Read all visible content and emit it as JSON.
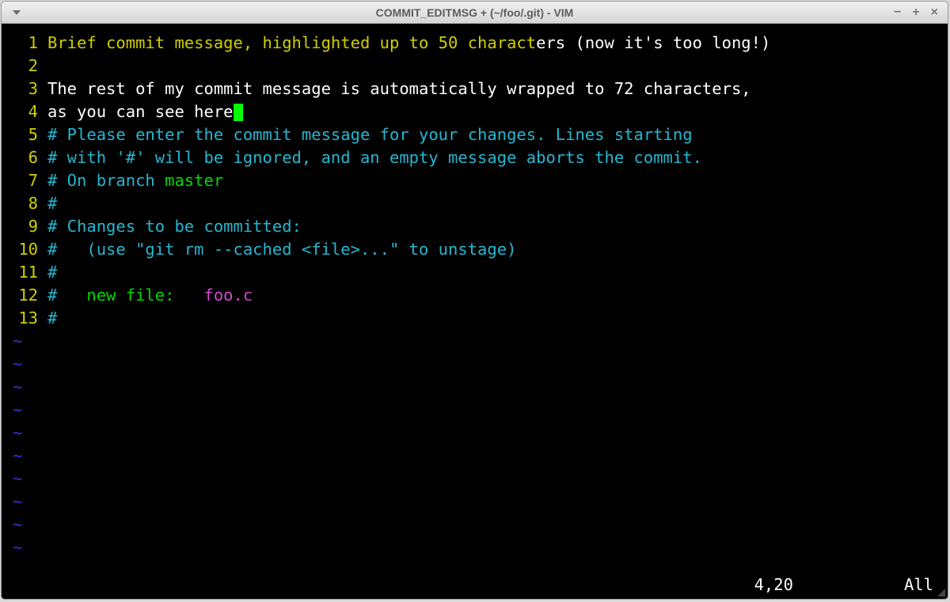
{
  "window": {
    "title": "COMMIT_EDITMSG + (~/foo/.git) - VIM"
  },
  "lines": [
    {
      "num": "1",
      "segments": [
        {
          "style": "c-yellow",
          "text": "Brief commit message, highlighted up to 50 charact"
        },
        {
          "style": "c-white",
          "text": "ers (now it's too long!)"
        }
      ]
    },
    {
      "num": "2",
      "segments": []
    },
    {
      "num": "3",
      "segments": [
        {
          "style": "c-white",
          "text": "The rest of my commit message is automatically wrapped to 72 characters,"
        }
      ]
    },
    {
      "num": "4",
      "cursor_after": true,
      "segments": [
        {
          "style": "c-white",
          "text": "as you can see here"
        }
      ]
    },
    {
      "num": "5",
      "segments": [
        {
          "style": "c-blue",
          "text": "# Please enter the commit message for your changes. Lines starting"
        }
      ]
    },
    {
      "num": "6",
      "segments": [
        {
          "style": "c-blue",
          "text": "# with '#' will be ignored, and an empty message aborts the commit."
        }
      ]
    },
    {
      "num": "7",
      "segments": [
        {
          "style": "c-blue",
          "text": "# On branch "
        },
        {
          "style": "c-green",
          "text": "master"
        }
      ]
    },
    {
      "num": "8",
      "segments": [
        {
          "style": "c-blue",
          "text": "#"
        }
      ]
    },
    {
      "num": "9",
      "segments": [
        {
          "style": "c-blue",
          "text": "# Changes to be committed:"
        }
      ]
    },
    {
      "num": "10",
      "segments": [
        {
          "style": "c-blue",
          "text": "#   (use \"git rm --cached <file>...\" to unstage)"
        }
      ]
    },
    {
      "num": "11",
      "segments": [
        {
          "style": "c-blue",
          "text": "#"
        }
      ]
    },
    {
      "num": "12",
      "segments": [
        {
          "style": "c-blue",
          "text": "#"
        },
        {
          "style": "c-plain",
          "text": "   "
        },
        {
          "style": "c-green",
          "text": "new file:   "
        },
        {
          "style": "c-magenta",
          "text": "foo.c"
        }
      ]
    },
    {
      "num": "13",
      "segments": [
        {
          "style": "c-blue",
          "text": "#"
        }
      ]
    }
  ],
  "tilde_rows": 10,
  "tilde_char": "~",
  "status": {
    "position": "4,20",
    "scroll": "All"
  }
}
